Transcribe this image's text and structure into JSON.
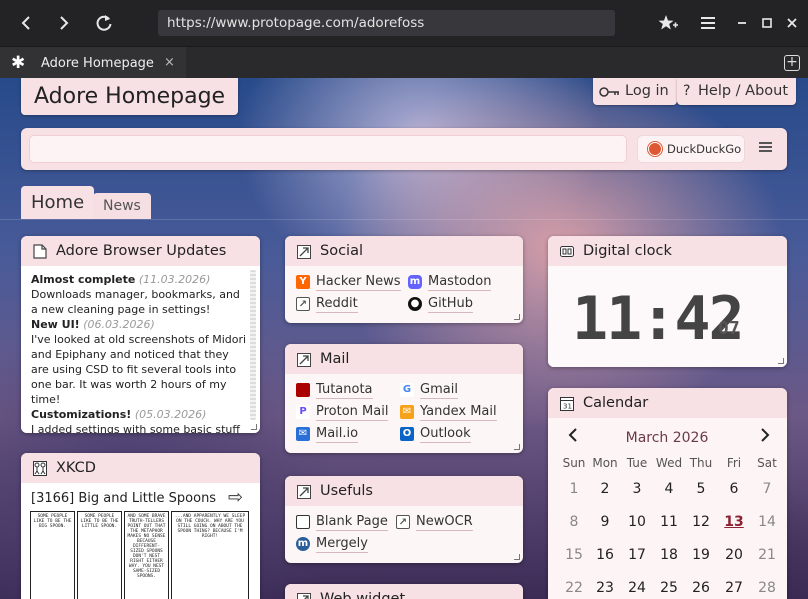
{
  "browser": {
    "url": "https://www.protopage.com/adorefoss",
    "tab_title": "Adore Homepage",
    "tab_close": "×",
    "new_tab": "+"
  },
  "page": {
    "title": "Adore Homepage",
    "login_label": "Log in",
    "help_label": "Help / About",
    "search_engine": "DuckDuckGo",
    "tabs": [
      "Home",
      "News"
    ]
  },
  "widgets": {
    "updates": {
      "title": "Adore Browser Updates",
      "entries": [
        {
          "heading": "Almost complete",
          "date": "(11.03.2026)",
          "text": "Downloads manager, bookmarks, and a new cleaning page in settings!"
        },
        {
          "heading": "New UI!",
          "date": "(06.03.2026)",
          "text": "I've looked at old screenshots of Midori and Epiphany and noticed that they are using CSD to fit several tools into one bar. It was worth 2 hours of my time!"
        },
        {
          "heading": "Customizations!",
          "date": "(05.03.2026)",
          "text": "I added settings with some basic stuff and proxy support."
        }
      ]
    },
    "xkcd": {
      "title": "XKCD",
      "comic_title": "[3166] Big and Little Spoons",
      "panels": [
        "SOME PEOPLE LIKE TO BE THE BIG SPOON.",
        "SOME PEOPLE LIKE TO BE THE LITTLE SPOON.",
        "AND SOME BRAVE TRUTH-TELLERS POINT OUT THAT THE METAPHOR MAKES NO SENSE BECAUSE DIFFERENT-SIZED SPOONS DON'T NEST RIGHT EITHER WAY. YOU NEST SAME-SIZED SPOONS.",
        "...AND APPARENTLY WE SLEEP ON THE COUCH. WHY ARE YOU STILL GOING ON ABOUT THE SPOON THING? BECAUSE I'M RIGHT!"
      ]
    },
    "social": {
      "title": "Social",
      "links": [
        "Hacker News",
        "Mastodon",
        "Reddit",
        "GitHub"
      ]
    },
    "mail": {
      "title": "Mail",
      "links": [
        "Tutanota",
        "Gmail",
        "Proton Mail",
        "Yandex Mail",
        "Mail.io",
        "Outlook"
      ]
    },
    "usefuls": {
      "title": "Usefuls",
      "links": [
        "Blank Page",
        "NewOCR",
        "Mergely"
      ]
    },
    "web_widget": {
      "title": "Web widget"
    },
    "clock": {
      "title": "Digital clock",
      "time": "11:42",
      "seconds": "07"
    },
    "calendar": {
      "title": "Calendar",
      "month": "March 2026",
      "prev": "<",
      "next": ">",
      "weekdays": [
        "Sun",
        "Mon",
        "Tue",
        "Wed",
        "Thu",
        "Fri",
        "Sat"
      ],
      "weeks": [
        [
          "1",
          "2",
          "3",
          "4",
          "5",
          "6",
          "7"
        ],
        [
          "8",
          "9",
          "10",
          "11",
          "12",
          "13",
          "14"
        ],
        [
          "15",
          "16",
          "17",
          "18",
          "19",
          "20",
          "21"
        ],
        [
          "22",
          "23",
          "24",
          "25",
          "26",
          "27",
          "28"
        ]
      ],
      "today": "13"
    }
  },
  "colors": {
    "widget_header": "#f8e1e4",
    "accent_today": "#8a2433"
  }
}
